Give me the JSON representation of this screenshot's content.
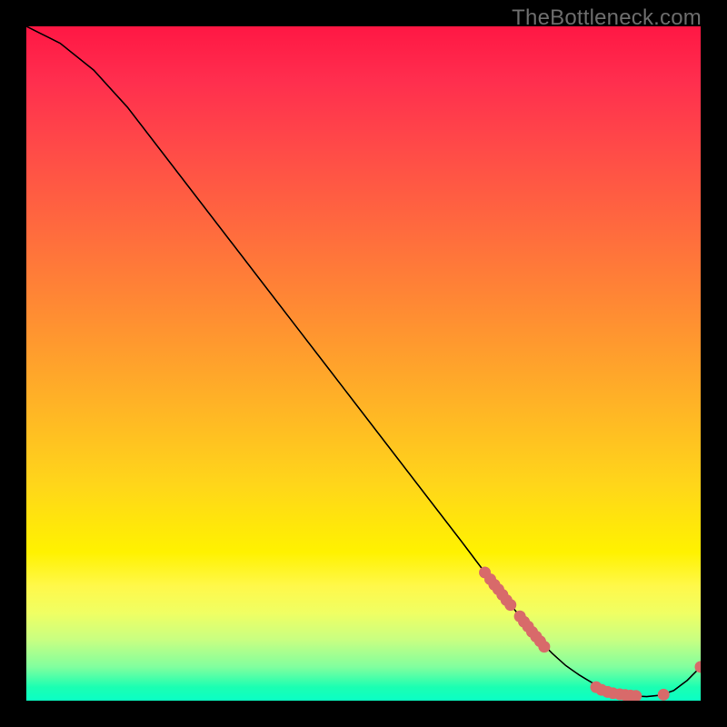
{
  "watermark": "TheBottleneck.com",
  "colors": {
    "curve": "#000000",
    "marker_fill": "#d86a6a",
    "marker_stroke": "#cf5757",
    "background": "#000000"
  },
  "chart_data": {
    "type": "line",
    "title": "",
    "xlabel": "",
    "ylabel": "",
    "xlim": [
      0,
      100
    ],
    "ylim": [
      0,
      100
    ],
    "grid": false,
    "legend": false,
    "series": [
      {
        "name": "bottleneck-curve",
        "x": [
          0,
          5,
          10,
          15,
          20,
          25,
          30,
          35,
          40,
          45,
          50,
          55,
          60,
          65,
          68,
          70,
          72,
          74,
          76,
          78,
          80,
          82,
          84,
          86,
          88,
          90,
          92,
          94,
          96,
          98,
          100
        ],
        "y": [
          100,
          97.5,
          93.5,
          88,
          81.5,
          75,
          68.5,
          62,
          55.5,
          49,
          42.5,
          36,
          29.5,
          23,
          19,
          16.5,
          14,
          11.5,
          9,
          7,
          5.2,
          3.8,
          2.6,
          1.6,
          1.0,
          0.7,
          0.6,
          0.8,
          1.5,
          3.0,
          5.0
        ]
      }
    ],
    "markers": [
      {
        "x": 68.0,
        "y": 19.0
      },
      {
        "x": 68.8,
        "y": 18.0
      },
      {
        "x": 69.4,
        "y": 17.2
      },
      {
        "x": 70.0,
        "y": 16.5
      },
      {
        "x": 70.6,
        "y": 15.7
      },
      {
        "x": 71.2,
        "y": 14.9
      },
      {
        "x": 71.8,
        "y": 14.2
      },
      {
        "x": 73.2,
        "y": 12.5
      },
      {
        "x": 73.8,
        "y": 11.7
      },
      {
        "x": 74.4,
        "y": 11.0
      },
      {
        "x": 75.0,
        "y": 10.2
      },
      {
        "x": 75.6,
        "y": 9.5
      },
      {
        "x": 76.2,
        "y": 8.8
      },
      {
        "x": 76.8,
        "y": 8.0
      },
      {
        "x": 84.5,
        "y": 2.0
      },
      {
        "x": 85.3,
        "y": 1.6
      },
      {
        "x": 86.2,
        "y": 1.3
      },
      {
        "x": 87.0,
        "y": 1.1
      },
      {
        "x": 88.0,
        "y": 0.95
      },
      {
        "x": 88.8,
        "y": 0.85
      },
      {
        "x": 89.6,
        "y": 0.75
      },
      {
        "x": 90.4,
        "y": 0.7
      },
      {
        "x": 94.5,
        "y": 0.9
      },
      {
        "x": 100.0,
        "y": 5.0
      }
    ]
  }
}
